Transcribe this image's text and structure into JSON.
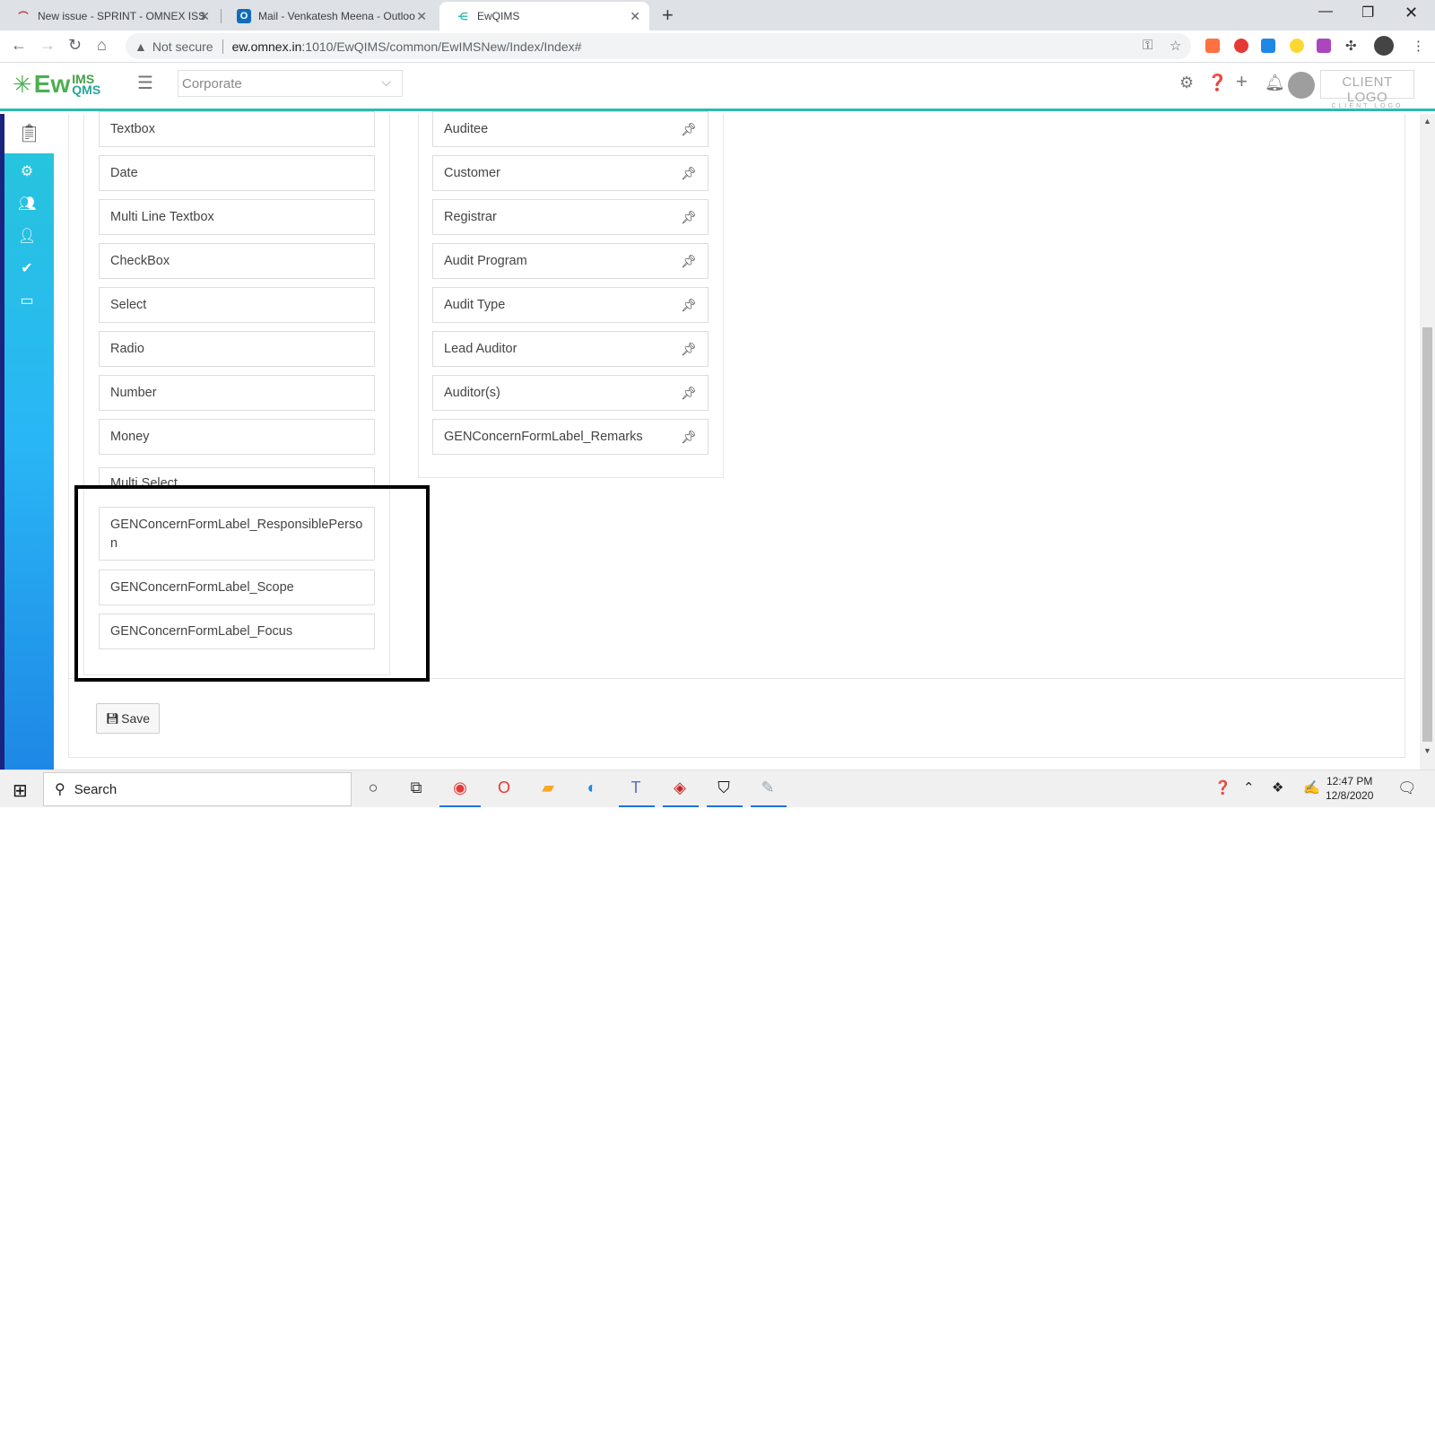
{
  "browser": {
    "tabs": [
      {
        "title": "New issue - SPRINT - OMNEX ISS",
        "icon": "jira-icon"
      },
      {
        "title": "Mail - Venkatesh Meena - Outloo",
        "icon": "outlook-icon"
      },
      {
        "title": "EwQIMS",
        "icon": "ewqims-icon"
      }
    ],
    "security_label": "Not secure",
    "url_host": "ew.omnex.in",
    "url_path": ":1010/EwQIMS/common/EwIMSNew/Index/Index#"
  },
  "app": {
    "logo_text": "Ew",
    "logo_ims": "IMS",
    "logo_qms": "QMS",
    "org_select": "Corporate",
    "client_logo": "CLIENT LOGO",
    "client_logo_sub": "CLIENT LOGO"
  },
  "left_fields": [
    "Textbox",
    "Date",
    "Multi Line Textbox",
    "CheckBox",
    "Select",
    "Radio",
    "Number",
    "Money",
    "Multi Select",
    "GENConcernFormLabel_ResponsiblePerson",
    "GENConcernFormLabel_Scope",
    "GENConcernFormLabel_Focus"
  ],
  "right_fields": [
    "Auditee",
    "Customer",
    "Registrar",
    "Audit Program",
    "Audit Type",
    "Lead Auditor",
    "Auditor(s)",
    "GENConcernFormLabel_Remarks"
  ],
  "save_label": "Save",
  "taskbar": {
    "search_placeholder": "Search",
    "time": "12:47 PM",
    "date": "12/8/2020"
  },
  "colors": {
    "accent": "#2bbbad",
    "sidebar_top": "#26c6da",
    "sidebar_bottom": "#1e88e5",
    "highlight_border": "#000000"
  }
}
